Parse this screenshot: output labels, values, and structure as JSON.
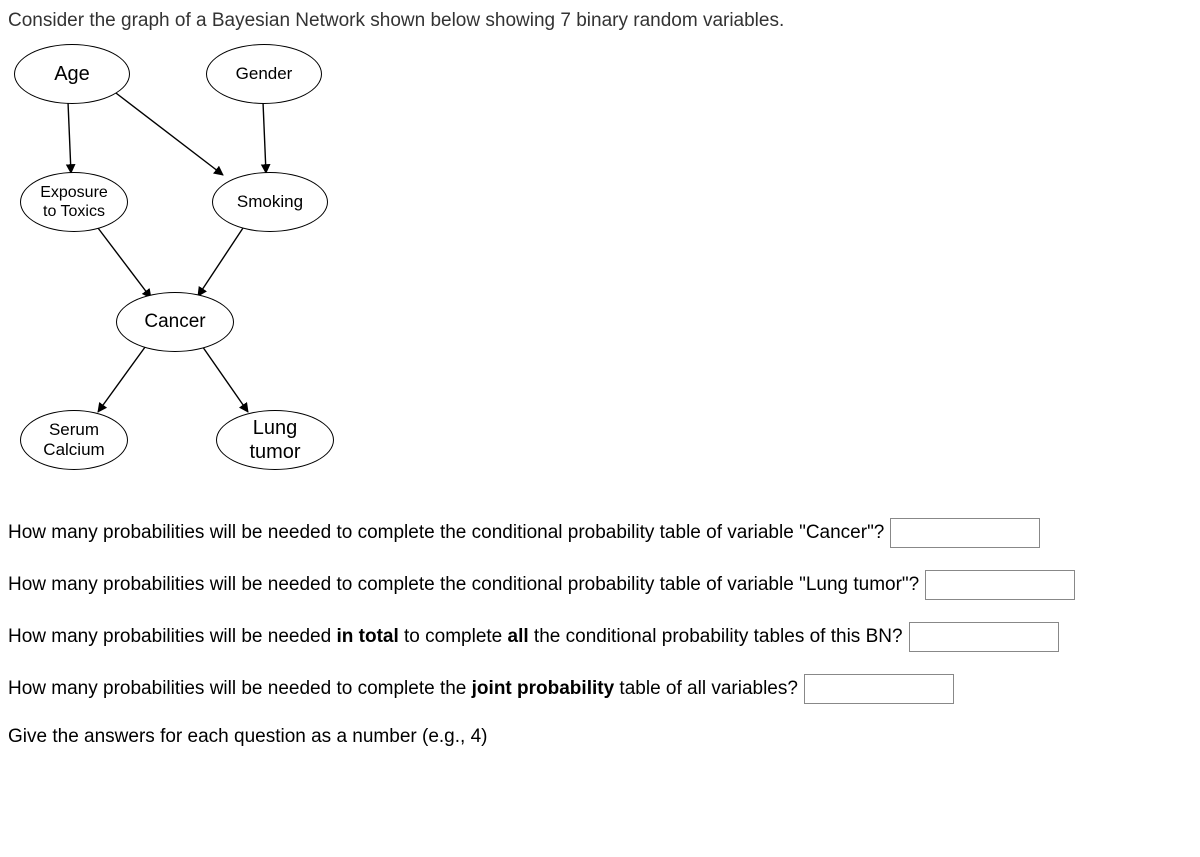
{
  "intro": "Consider the graph of a Bayesian Network shown below showing 7 binary random variables.",
  "nodes": {
    "age": "Age",
    "gender": "Gender",
    "exposure": "Exposure\nto Toxics",
    "smoking": "Smoking",
    "cancer": "Cancer",
    "serum": "Serum\nCalcium",
    "lung": "Lung\ntumor"
  },
  "questions": {
    "q1": "How many probabilities will be needed to complete the conditional probability table of variable \"Cancer\"?",
    "q2": "How many probabilities will be needed to complete the conditional probability table of variable \"Lung tumor\"?",
    "q3_pre": "How many probabilities will be needed ",
    "q3_b1": "in total",
    "q3_mid": " to complete ",
    "q3_b2": "all",
    "q3_post": " the conditional probability tables of this BN?",
    "q4_pre": "How many probabilities will be needed to complete the ",
    "q4_b": "joint probability",
    "q4_post": " table of all variables?",
    "hint": "Give the answers for each question as a number (e.g., 4)"
  },
  "input_values": {
    "q1": "",
    "q2": "",
    "q3": "",
    "q4": ""
  }
}
